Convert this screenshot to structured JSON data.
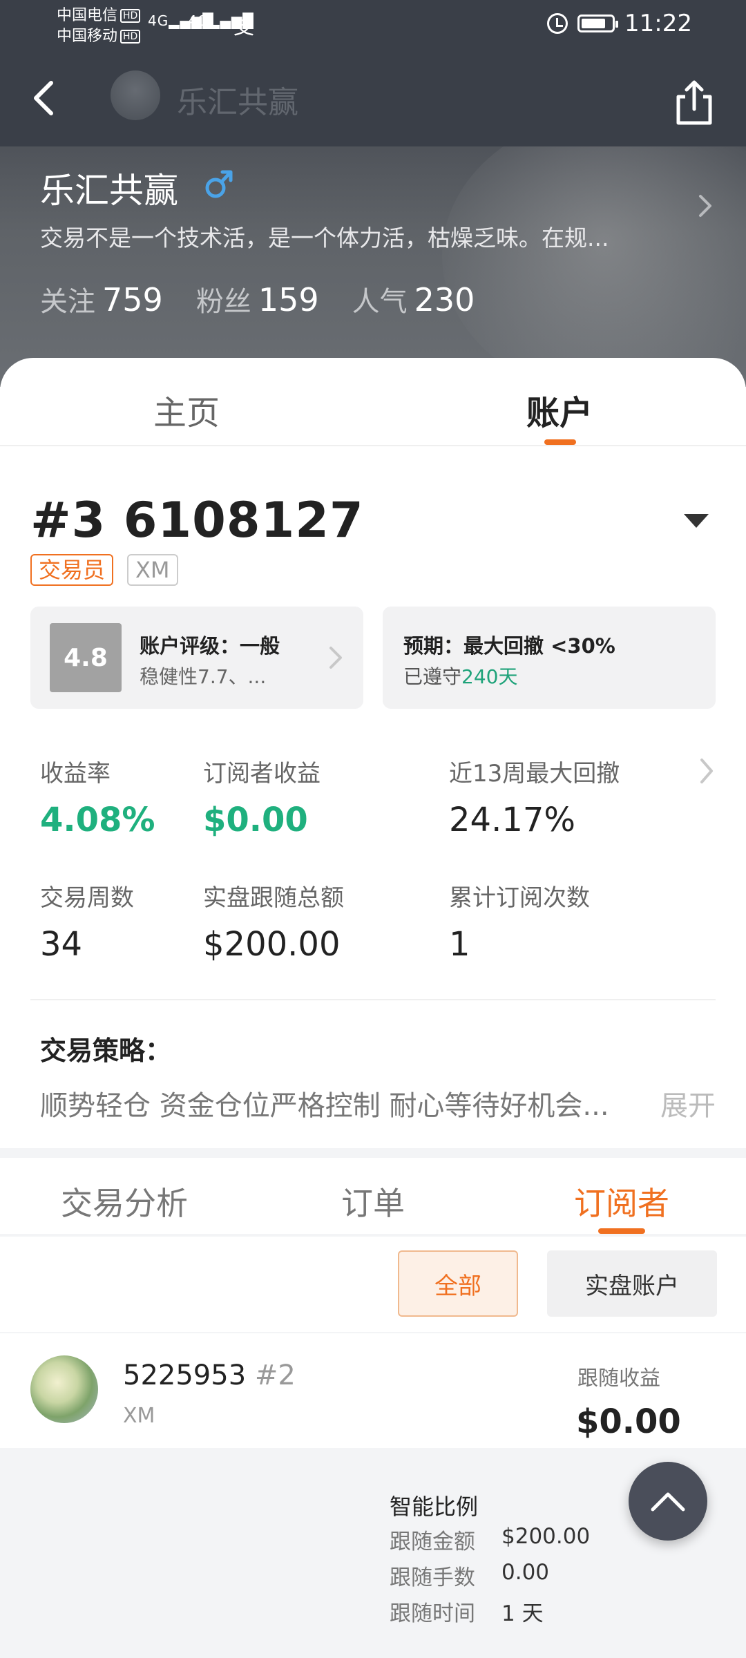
{
  "status_bar": {
    "carrier1": "中国电信",
    "carrier2": "中国移动",
    "hd": "HD",
    "signal1": "4G",
    "signal2": "4G",
    "app_glyph": "支",
    "time": "11:22"
  },
  "nav": {
    "title": "乐汇共赢"
  },
  "profile": {
    "name": "乐汇共赢",
    "bio": "交易不是一个技术活，是一个体力活，枯燥乏味。在规...",
    "follow_label": "关注",
    "follow_value": "759",
    "fans_label": "粉丝",
    "fans_value": "159",
    "popularity_label": "人气",
    "popularity_value": "230"
  },
  "top_tabs": [
    {
      "label": "主页",
      "active": false
    },
    {
      "label": "账户",
      "active": true
    }
  ],
  "account": {
    "number": "#3 6108127",
    "role_tag": "交易员",
    "broker_tag": "XM",
    "score": "4.8",
    "rating_title": "账户评级：一般",
    "rating_sub": "稳健性7.7、...",
    "expect_title": "预期：最大回撤 <30%",
    "expect_prefix": "已遵守",
    "expect_days": "240天"
  },
  "metrics": [
    {
      "label": "收益率",
      "value": "4.08%",
      "highlight": true
    },
    {
      "label": "订阅者收益",
      "value": "$0.00",
      "highlight": true
    },
    {
      "label": "近13周最大回撤",
      "value": "24.17%",
      "highlight": false
    },
    {
      "label": "交易周数",
      "value": "34",
      "highlight": false
    },
    {
      "label": "实盘跟随总额",
      "value": "$200.00",
      "highlight": false
    },
    {
      "label": "累计订阅次数",
      "value": "1",
      "highlight": false
    }
  ],
  "strategy": {
    "title": "交易策略：",
    "text": "顺势轻仓 资金仓位严格控制 耐心等待好机会...",
    "more": "展开"
  },
  "lower_tabs": [
    {
      "label": "交易分析",
      "active": false
    },
    {
      "label": "订单",
      "active": false
    },
    {
      "label": "订阅者",
      "active": true
    }
  ],
  "filters": {
    "all": "全部",
    "live": "实盘账户"
  },
  "subscriber": {
    "id": "5225953",
    "rank": "#2",
    "broker": "XM",
    "profit_label": "跟随收益",
    "profit_value": "$0.00"
  },
  "details": {
    "mode": "智能比例",
    "rows": [
      {
        "label": "跟随金额",
        "value": "$200.00"
      },
      {
        "label": "跟随手数",
        "value": "0.00"
      },
      {
        "label": "跟随时间",
        "value": "1 天"
      }
    ]
  },
  "colors": {
    "accent_orange": "#f07020",
    "positive_green": "#1fb07e",
    "header_dark": "#3a3f48"
  }
}
